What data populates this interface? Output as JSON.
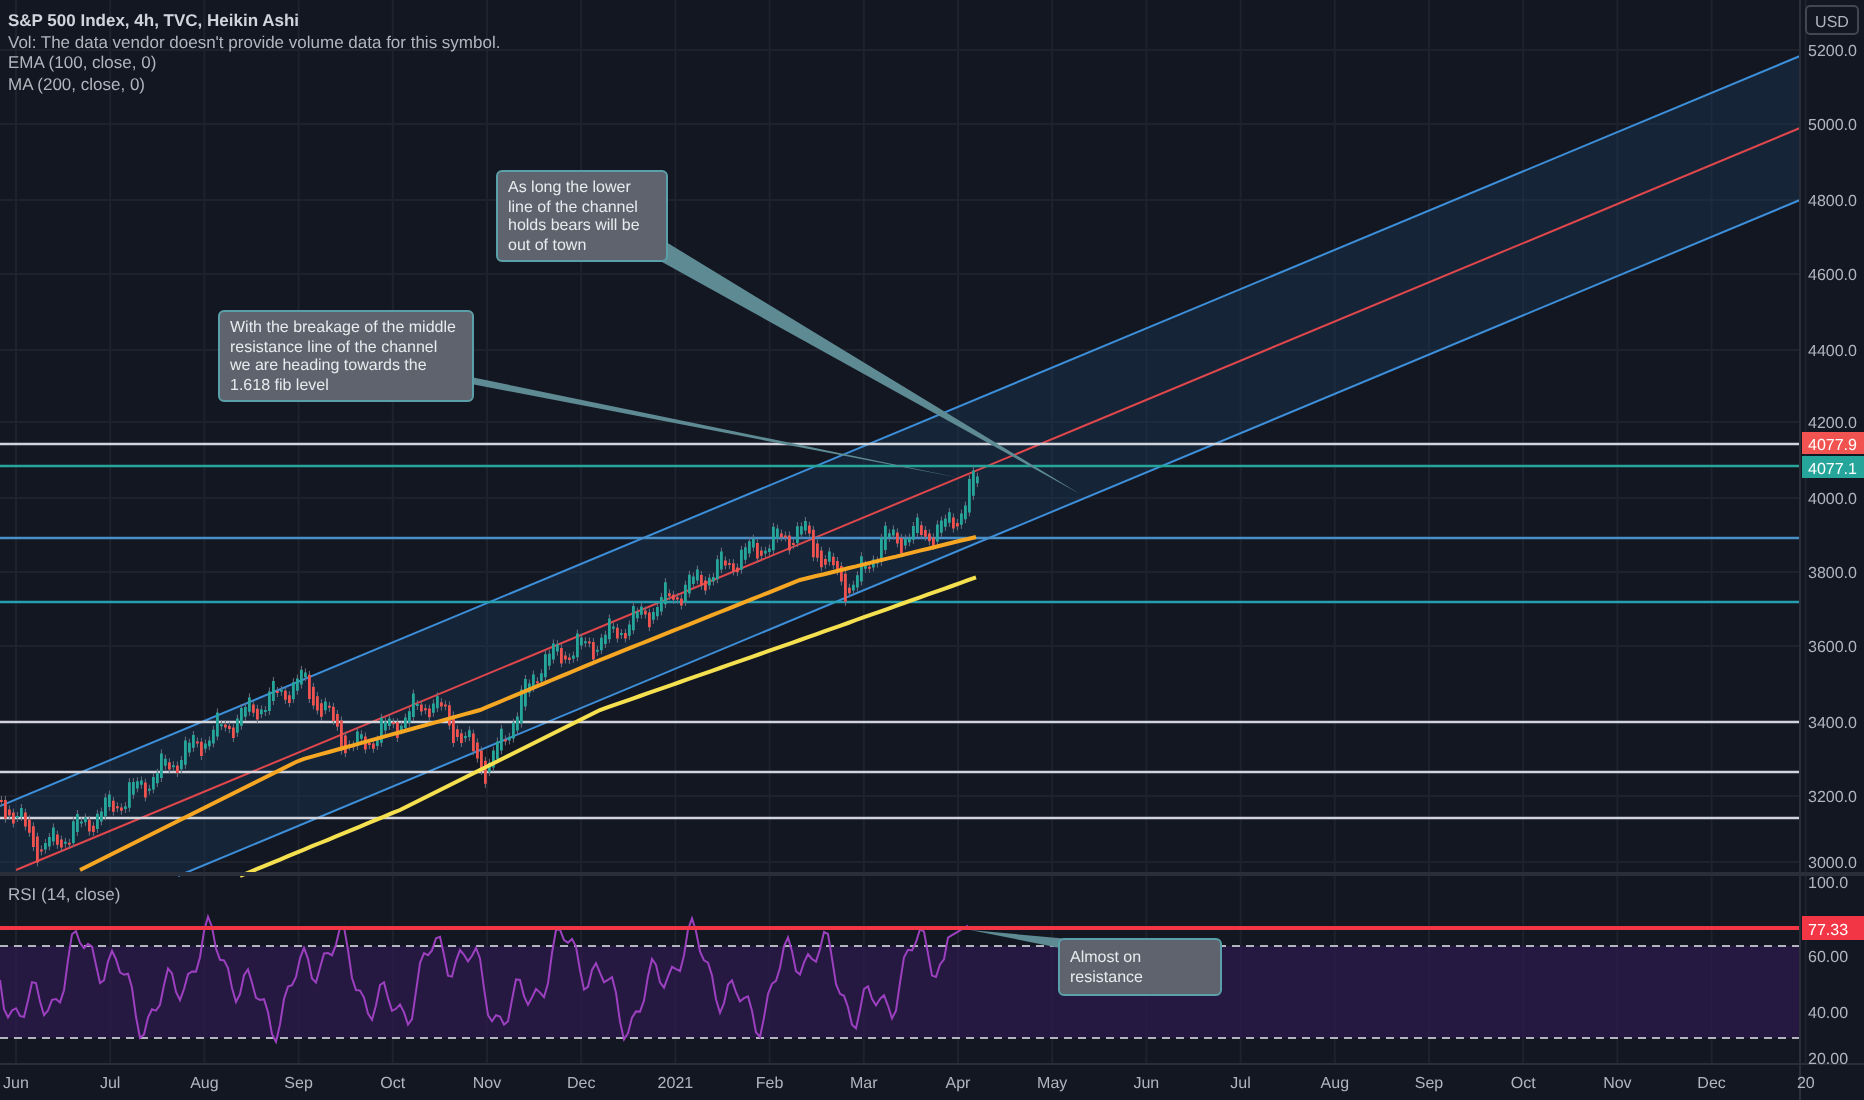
{
  "legend": {
    "title": "S&P 500 Index, 4h, TVC, Heikin Ashi",
    "lines": [
      "Vol: The data vendor doesn't provide volume data for this symbol.",
      "EMA (100, close, 0)",
      "MA (200, close, 0)"
    ]
  },
  "price_axis": {
    "currency": "USD",
    "labels": [
      "5200.0",
      "5000.0",
      "4800.0",
      "4600.0",
      "4400.0",
      "4200.0",
      "4000.0",
      "3800.0",
      "3600.0",
      "3400.0",
      "3200.0",
      "3000.0"
    ],
    "badges": [
      {
        "text": "4077.9",
        "color": "#f05350"
      },
      {
        "text": "4077.1",
        "color": "#26a69a"
      }
    ]
  },
  "callouts": [
    {
      "text": "As long the lower line of the channel holds bears will be out of town"
    },
    {
      "text": "With the breakage of the middle resistance line of the channel we are heading towards the 1.618 fib level"
    }
  ],
  "rsi": {
    "title": "RSI (14, close)",
    "labels": [
      "100.0",
      "60.00",
      "40.00",
      "20.00"
    ],
    "badge": {
      "text": "77.33",
      "color": "#f23645"
    },
    "callout": "Almost on resistance"
  },
  "time_axis": [
    "Jun",
    "Jul",
    "Aug",
    "Sep",
    "Oct",
    "Nov",
    "Dec",
    "2021",
    "Feb",
    "Mar",
    "Apr",
    "May",
    "Jun",
    "Jul",
    "Aug",
    "Sep",
    "Oct",
    "Nov",
    "Dec",
    "20"
  ]
}
